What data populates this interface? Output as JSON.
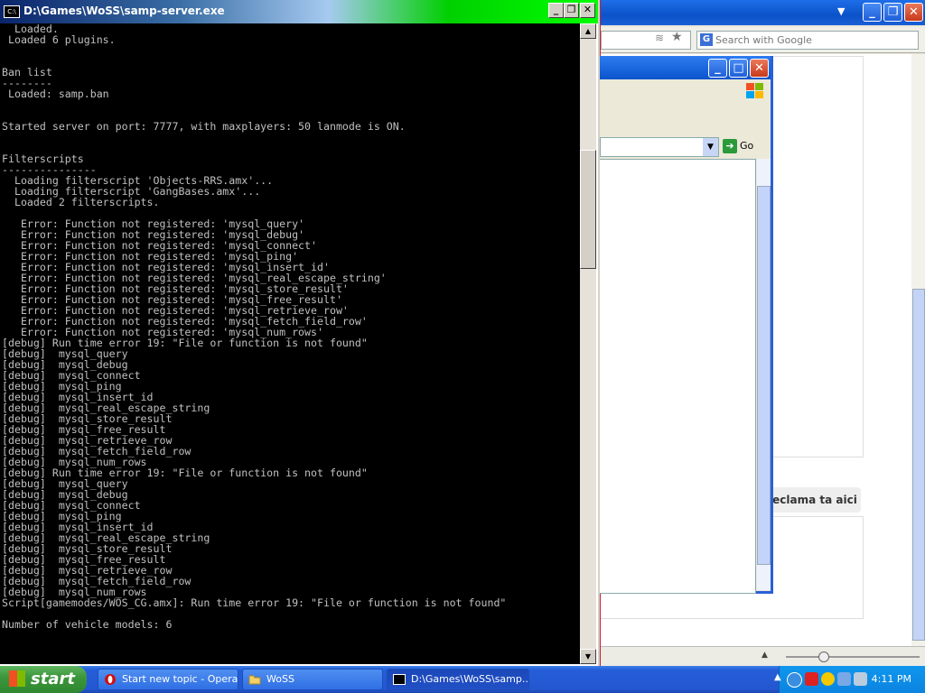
{
  "console": {
    "title": "D:\\Games\\WoSS\\samp-server.exe",
    "lines": [
      "  Loaded.",
      " Loaded 6 plugins.",
      "",
      "",
      "Ban list",
      "--------",
      " Loaded: samp.ban",
      "",
      "",
      "Started server on port: 7777, with maxplayers: 50 lanmode is ON.",
      "",
      "",
      "Filterscripts",
      "---------------",
      "  Loading filterscript 'Objects-RRS.amx'...",
      "  Loading filterscript 'GangBases.amx'...",
      "  Loaded 2 filterscripts.",
      "",
      "   Error: Function not registered: 'mysql_query'",
      "   Error: Function not registered: 'mysql_debug'",
      "   Error: Function not registered: 'mysql_connect'",
      "   Error: Function not registered: 'mysql_ping'",
      "   Error: Function not registered: 'mysql_insert_id'",
      "   Error: Function not registered: 'mysql_real_escape_string'",
      "   Error: Function not registered: 'mysql_store_result'",
      "   Error: Function not registered: 'mysql_free_result'",
      "   Error: Function not registered: 'mysql_retrieve_row'",
      "   Error: Function not registered: 'mysql_fetch_field_row'",
      "   Error: Function not registered: 'mysql_num_rows'",
      "[debug] Run time error 19: \"File or function is not found\"",
      "[debug]  mysql_query",
      "[debug]  mysql_debug",
      "[debug]  mysql_connect",
      "[debug]  mysql_ping",
      "[debug]  mysql_insert_id",
      "[debug]  mysql_real_escape_string",
      "[debug]  mysql_store_result",
      "[debug]  mysql_free_result",
      "[debug]  mysql_retrieve_row",
      "[debug]  mysql_fetch_field_row",
      "[debug]  mysql_num_rows",
      "[debug] Run time error 19: \"File or function is not found\"",
      "[debug]  mysql_query",
      "[debug]  mysql_debug",
      "[debug]  mysql_connect",
      "[debug]  mysql_ping",
      "[debug]  mysql_insert_id",
      "[debug]  mysql_real_escape_string",
      "[debug]  mysql_store_result",
      "[debug]  mysql_free_result",
      "[debug]  mysql_retrieve_row",
      "[debug]  mysql_fetch_field_row",
      "[debug]  mysql_num_rows",
      "Script[gamemodes/WOS_CG.amx]: Run time error 19: \"File or function is not found\"",
      "",
      "Number of vehicle models: 6"
    ],
    "colors": {
      "background": "#000000",
      "text": "#c0c0c0"
    }
  },
  "browser": {
    "search_placeholder": "Search with Google",
    "search_engine_icon": "G",
    "reclama_label": "eclama ta aici",
    "go_label": "Go"
  },
  "taskbar": {
    "start_label": "start",
    "tasks": [
      {
        "label": "Start new topic - Opera",
        "icon": "opera-icon"
      },
      {
        "label": "WoSS",
        "icon": "folder-icon"
      },
      {
        "label": "D:\\Games\\WoSS\\samp...",
        "icon": "console-icon"
      }
    ],
    "clock": "4:11 PM"
  }
}
